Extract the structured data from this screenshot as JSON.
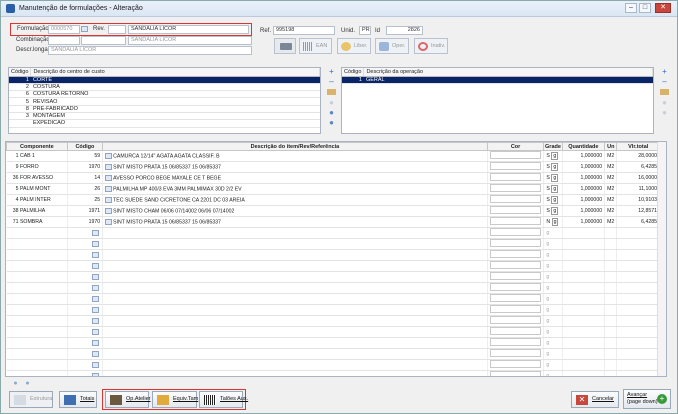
{
  "window": {
    "title": "Manutenção de formulações - Alteração",
    "min": "–",
    "max": "□",
    "close": "✕"
  },
  "header": {
    "formulacao_label": "Formulação",
    "formulacao_value": "0000570",
    "rev_label": "Rev.",
    "rev_value": "",
    "desc_value": "SANDALIA LICOR",
    "combinacao_label": "Combinação",
    "combinacao_value": "",
    "combinacao_desc": "SANDALIA LICOR",
    "descr_longa_label": "Descr.longa",
    "descr_longa_value": "SANDALIA LICOR",
    "ref_label": "Ref.",
    "ref_value": "995198",
    "unid_label": "Unid.",
    "unid_value": "PR",
    "id_label": "Id",
    "id_value": "2826"
  },
  "toolbar": {
    "ean": "EAN",
    "liber": "Liber.",
    "oper": "Oper.",
    "inativ": "Inativ."
  },
  "centros": {
    "col_codigo": "Código",
    "col_desc": "Descrição do centro de custo",
    "rows": [
      {
        "code": "1",
        "desc": "CORTE"
      },
      {
        "code": "2",
        "desc": "COSTURA"
      },
      {
        "code": "6",
        "desc": "COSTURA RETORNO"
      },
      {
        "code": "5",
        "desc": "REVISAO"
      },
      {
        "code": "8",
        "desc": "PRE-FABRICADO"
      },
      {
        "code": "3",
        "desc": "MONTAGEM"
      },
      {
        "code": "",
        "desc": "EXPEDICAO"
      }
    ]
  },
  "operacoes": {
    "col_codigo": "Código",
    "col_desc": "Descrição da operação",
    "rows": [
      {
        "code": "1",
        "desc": "GERAL"
      }
    ]
  },
  "grid": {
    "headers": {
      "componente": "Componente",
      "codigo": "Código",
      "descricao": "Descrição do item/Rev/Referência",
      "cor": "Cor",
      "grade": "Grade",
      "quantidade": "Quantidade",
      "un": "Un",
      "vlr_total": "Vlr.total"
    },
    "rows": [
      {
        "seq": "1",
        "comp": "CAB 1",
        "code": "59",
        "desc": "CAMURCA 12/14\" AGATA              AGATA CLASSIF. B",
        "grade": "S",
        "qtd": "1,000000",
        "un": "M2",
        "total": "28,0000"
      },
      {
        "seq": "9",
        "comp": "FORRO",
        "code": "1970",
        "desc": "SINT MISTO PRATA 15 06/85337        15 06/85337",
        "grade": "S",
        "qtd": "1,000000",
        "un": "M2",
        "total": "6,4285"
      },
      {
        "seq": "36",
        "comp": "FOR AVESSO",
        "code": "14",
        "desc": "AVESSO PORCO BEGE                  MAYALE CE T BEGE",
        "grade": "S",
        "qtd": "1,000000",
        "un": "M2",
        "total": "16,0000"
      },
      {
        "seq": "5",
        "comp": "PALM MONT",
        "code": "26",
        "desc": "PALMILHA MP 400/3 EVA 3MM           PALMIMAX 30D 2/2 EV",
        "grade": "S",
        "qtd": "1,000000",
        "un": "M2",
        "total": "11,1000"
      },
      {
        "seq": "4",
        "comp": "PALM INTER",
        "code": "25",
        "desc": "TEC SUEDE SAND C/CRETONE            CA 2201 DC 03 AREIA",
        "grade": "S",
        "qtd": "1,000000",
        "un": "M2",
        "total": "10,9103"
      },
      {
        "seq": "38",
        "comp": "PALMILHA",
        "code": "1971",
        "desc": "SINT MISTO CHAM 06/06 07/14002      06/06 07/14002",
        "grade": "S",
        "qtd": "1,000000",
        "un": "M2",
        "total": "12,8571"
      },
      {
        "seq": "71",
        "comp": "SOMBRA",
        "code": "1970",
        "desc": "SINT MISTO PRATA 15 06/85337        15 06/85337",
        "grade": "N",
        "qtd": "1,000000",
        "un": "M2",
        "total": "6,4285"
      }
    ]
  },
  "footer": {
    "estrutura": "Estrutura",
    "totais": "Totais",
    "op_atelier": "Op.Atelier",
    "equiv_tam": "Equiv.Tam",
    "talloes_aux": "Talões Aux.",
    "cancelar": "Cancelar",
    "avancar": "Avançar",
    "avancar_sub": "(page down)"
  },
  "colors": {
    "selection": "#0a246a",
    "highlight": "#dd3333",
    "cancel": "#c9463d",
    "advance": "#3a9a3a"
  }
}
